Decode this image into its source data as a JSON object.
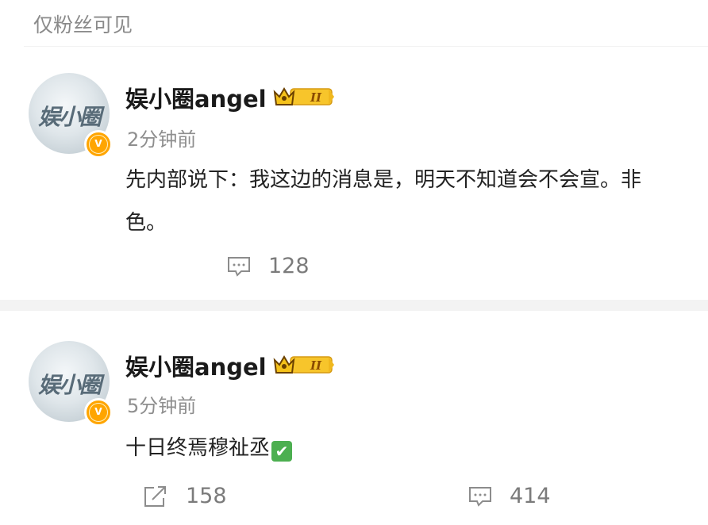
{
  "visibility_label": "仅粉丝可见",
  "posts": [
    {
      "avatar_text": "娱小圈",
      "verified_glyph": "v",
      "username": "娱小圈angel",
      "level_badge": "II",
      "time": "2分钟前",
      "content_lines": [
        "先内部说下：我这边的消息是，明天不知道会不会宣。非",
        "色。"
      ],
      "comment_count": "128"
    },
    {
      "avatar_text": "娱小圈",
      "verified_glyph": "v",
      "username": "娱小圈angel",
      "level_badge": "II",
      "time": "5分钟前",
      "content": "十日终焉穆祉丞",
      "content_emoji": "✔",
      "share_count": "158",
      "comment_count": "414"
    }
  ],
  "colors": {
    "verified_badge": "#ffa500",
    "crown": "#e0a90e",
    "check": "#4caf50"
  },
  "icons": [
    "comment-icon",
    "share-icon",
    "crown-icon",
    "verified-icon",
    "check-emoji-icon"
  ]
}
